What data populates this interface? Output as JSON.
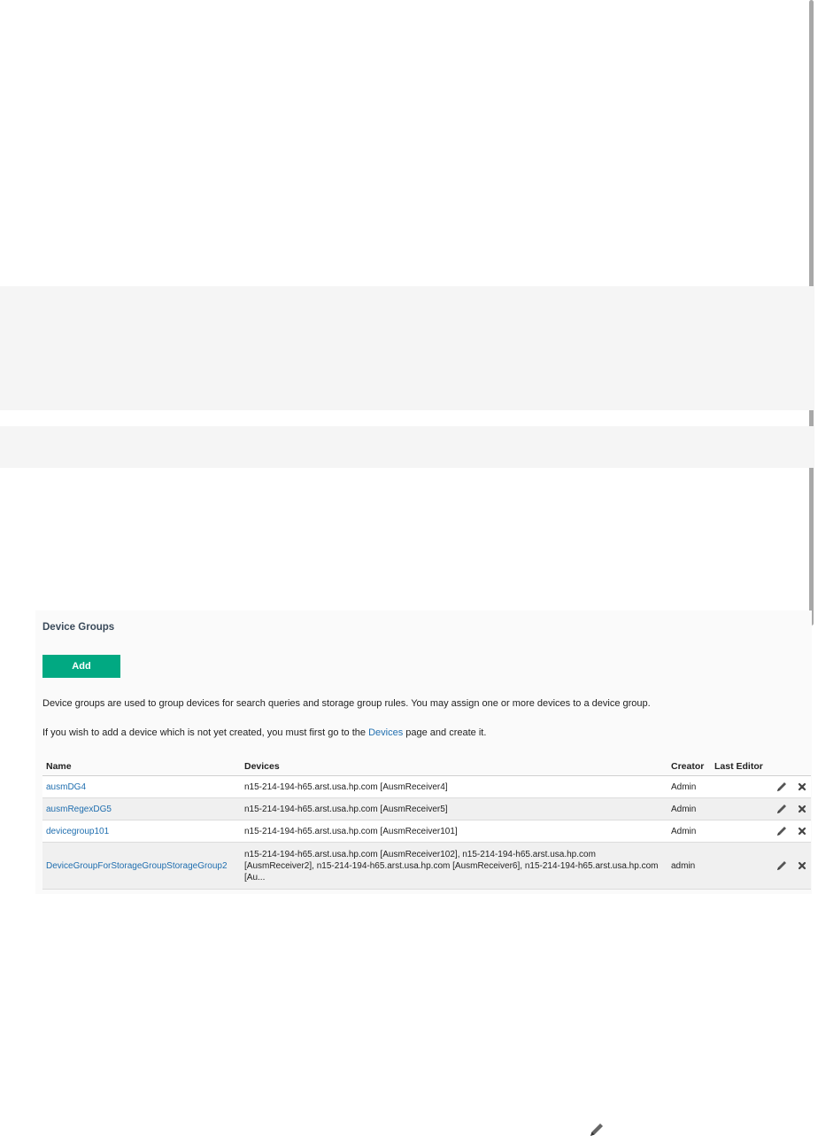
{
  "panel": {
    "title": "Device Groups",
    "add_label": "Add",
    "description": "Device groups are used to group devices for search queries and storage group rules. You may assign one or more devices to a device group.",
    "hint_before": "If you wish to add a device which is not yet created, you must first go to the",
    "hint_link": "Devices",
    "hint_after": "page and create it."
  },
  "table": {
    "headers": {
      "name": "Name",
      "devices": "Devices",
      "creator": "Creator",
      "last_editor": "Last Editor"
    },
    "rows": [
      {
        "name": "ausmDG4",
        "devices": "n15-214-194-h65.arst.usa.hp.com [AusmReceiver4]",
        "creator": "Admin",
        "last_editor": ""
      },
      {
        "name": "ausmRegexDG5",
        "devices": "n15-214-194-h65.arst.usa.hp.com [AusmReceiver5]",
        "creator": "Admin",
        "last_editor": ""
      },
      {
        "name": "devicegroup101",
        "devices": "n15-214-194-h65.arst.usa.hp.com [AusmReceiver101]",
        "creator": "Admin",
        "last_editor": ""
      },
      {
        "name": "DeviceGroupForStorageGroupStorageGroup2",
        "devices": "n15-214-194-h65.arst.usa.hp.com [AusmReceiver102], n15-214-194-h65.arst.usa.hp.com [AusmReceiver2], n15-214-194-h65.arst.usa.hp.com [AusmReceiver6], n15-214-194-h65.arst.usa.hp.com [Au...",
        "creator": "admin",
        "last_editor": ""
      }
    ]
  },
  "icons": {
    "edit": "pencil-icon",
    "delete": "close-icon"
  },
  "colors": {
    "accent": "#01a982",
    "link": "#1f6eaf"
  }
}
